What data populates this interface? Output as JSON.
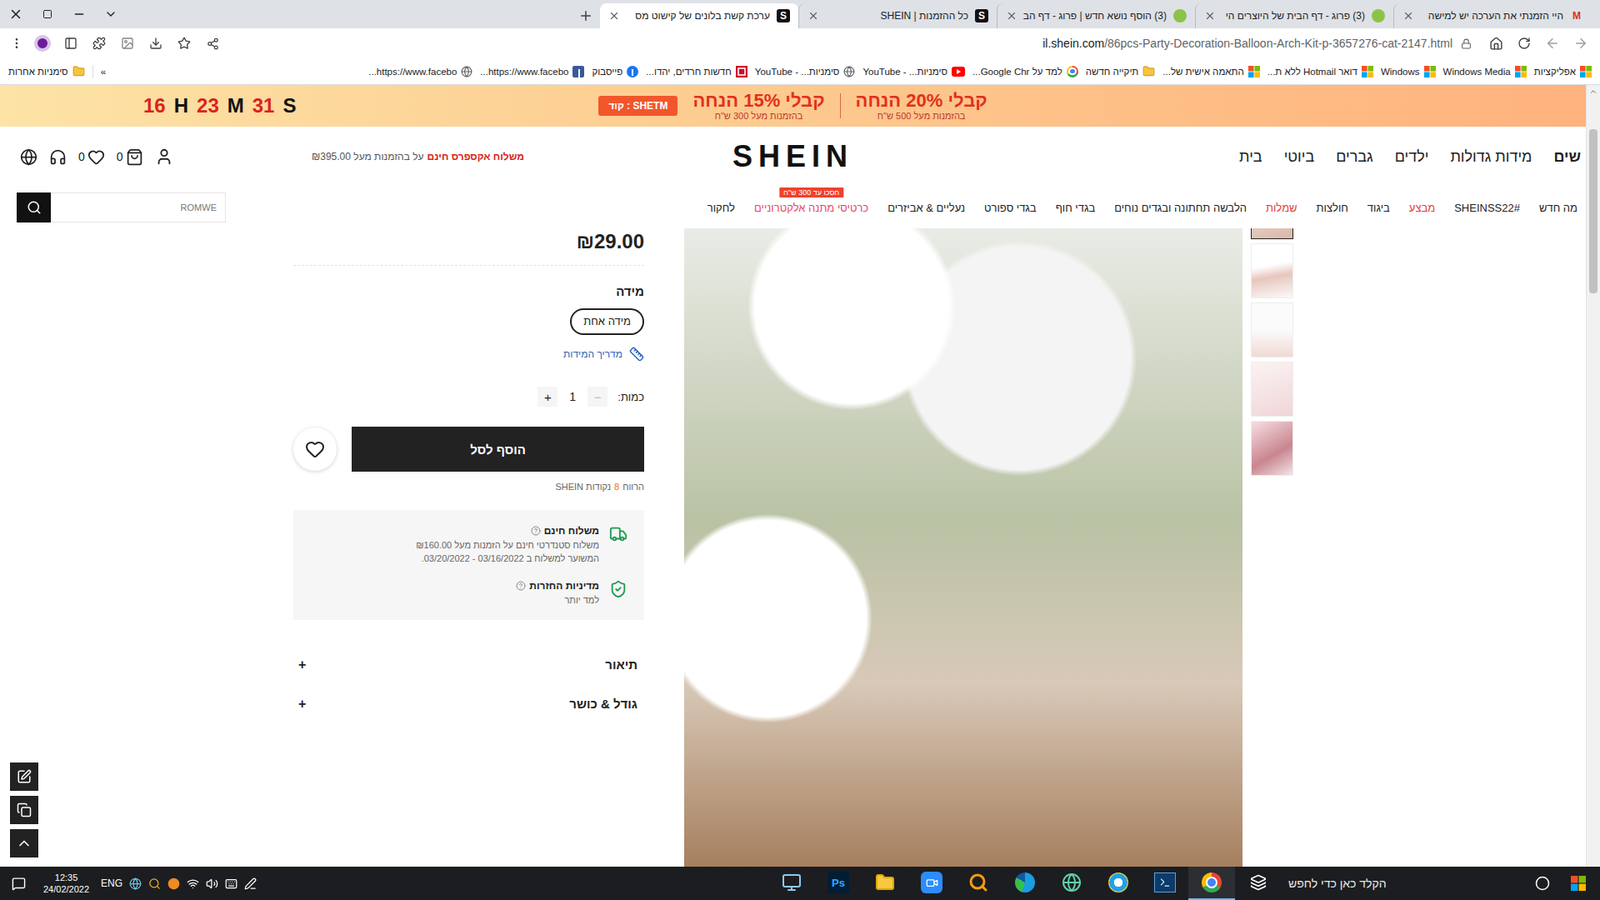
{
  "browser": {
    "tabs": [
      {
        "title": "היי הזמנתי את הערכה יש למישה",
        "selected": false,
        "favicon": {
          "kind": "gmail",
          "text": "M"
        }
      },
      {
        "title": "(3) פרוג - דף הבית של היוצרים הי",
        "selected": false,
        "favicon": {
          "kind": "prog"
        }
      },
      {
        "title": "(3) הוסף נושא חדש | פרוג - דף הב",
        "selected": false,
        "favicon": {
          "kind": "prog"
        }
      },
      {
        "title": "כל ההזמנות | SHEIN",
        "selected": false,
        "favicon": {
          "kind": "shein",
          "text": "S"
        }
      },
      {
        "title": "ערכת קשת בלונים של קישוט מס",
        "selected": true,
        "favicon": {
          "kind": "shein",
          "text": "S"
        }
      }
    ],
    "address": {
      "host": "il.shein.com",
      "path": "/86pcs-Party-Decoration-Balloon-Arch-Kit-p-3657276-cat-2147.html"
    },
    "bookmarks": [
      {
        "label": "אפליקציות",
        "kind": "apps"
      },
      {
        "label": "Windows Media",
        "kind": "windows"
      },
      {
        "label": "Windows",
        "kind": "windows"
      },
      {
        "label": "דואר Hotmail ללא ת...",
        "kind": "windows"
      },
      {
        "label": "התאמה אישית של...",
        "kind": "windows"
      },
      {
        "label": "תיקייה חדשה",
        "kind": "folder"
      },
      {
        "label": "למד על Google Chr...",
        "kind": "chrome"
      },
      {
        "label": "סימניות... - YouTube",
        "kind": "youtube"
      },
      {
        "label": "סימניות... - YouTube",
        "kind": "globe"
      },
      {
        "label": "חדשות חרדים, יהדו...",
        "kind": "news"
      },
      {
        "label": "פייסבוק",
        "kind": "facebook"
      },
      {
        "label": "https://www.facebo...",
        "kind": "facebook-square"
      },
      {
        "label": "https://www.facebo...",
        "kind": "globe"
      }
    ],
    "bookmarks_overflow": "»",
    "other_bookmarks": "סימניות אחרות"
  },
  "promo": {
    "countdown": [
      {
        "value": "16",
        "unit": "H"
      },
      {
        "value": "23",
        "unit": "M"
      },
      {
        "value": "31",
        "unit": "S"
      }
    ],
    "offers": [
      {
        "title": "קבלי 20% הנחה",
        "subtitle": "בהזמנות מעל 500 ש\"ח"
      },
      {
        "title": "קבלי 15% הנחה",
        "subtitle": "בהזמנות מעל 300 ש\"ח"
      }
    ],
    "code": "SHETM : קוד"
  },
  "header": {
    "nav": [
      {
        "label": "שים",
        "selected": true
      },
      {
        "label": "מידות גדולות",
        "selected": false
      },
      {
        "label": "ילדים",
        "selected": false
      },
      {
        "label": "גברים",
        "selected": false
      },
      {
        "label": "ביוטי",
        "selected": false
      },
      {
        "label": "בית",
        "selected": false
      }
    ],
    "logo": "SHEIN",
    "shipping": {
      "bold": "משלוח אקספרס חינם",
      "rest": "על בהזמנות מעל ₪395.00"
    },
    "wishlist_count": "0",
    "cart_count": "0"
  },
  "categories": [
    {
      "label": "מה חדש",
      "color": "#222222"
    },
    {
      "label": "#SHEINSS22",
      "color": "#222222"
    },
    {
      "label": "מבצע",
      "color": "#e23b3b"
    },
    {
      "label": "ביגוד",
      "color": "#222222"
    },
    {
      "label": "חולצות",
      "color": "#222222"
    },
    {
      "label": "שמלות",
      "color": "#e23b3b"
    },
    {
      "label": "הלבשה תחתונה ובגדים נוחים",
      "color": "#222222"
    },
    {
      "label": "בגדי חוף",
      "color": "#222222"
    },
    {
      "label": "בגדי ספורט",
      "color": "#222222"
    },
    {
      "label": "נעליים & אביזרים",
      "color": "#222222"
    },
    {
      "label": "כרטיסי מתנה אלקטרוניים",
      "color": "#e8475f",
      "badge": "חסכו עד 300 ש\"ח"
    },
    {
      "label": "לחקור",
      "color": "#222222"
    }
  ],
  "search": {
    "placeholder": "ROMWE"
  },
  "product": {
    "price": "₪29.00",
    "size_label": "מידה",
    "sizes": [
      {
        "label": "מידה אחת",
        "selected": true
      }
    ],
    "size_guide": "מדריך המידות",
    "quantity": {
      "label": "כמות:",
      "value": "1",
      "minus": "−",
      "plus": "+",
      "minus_disabled": true
    },
    "add_to_cart": "הוסף לסל",
    "wishlisted": false,
    "points": {
      "prefix": "הרווח",
      "value": "8",
      "suffix": "נקודות SHEIN"
    },
    "info": [
      {
        "kind": "shipping",
        "title": "משלוח חינם",
        "lines": [
          "משלוח סטנדרטי חינם על הזמנות מעל ₪160.00",
          "המשוער למשלוח ב 03/16/2022 - 03/20/2022."
        ]
      },
      {
        "kind": "returns",
        "title": "מדיניות החזרות",
        "lines": [
          "למד יותר"
        ]
      }
    ],
    "sections": [
      {
        "label": "תיאור",
        "expanded": false,
        "toggle": "+"
      },
      {
        "label": "גודל & כושר",
        "expanded": false,
        "toggle": "+"
      }
    ],
    "thumbnails": [
      {
        "selected": true
      },
      {
        "selected": false
      },
      {
        "selected": false
      },
      {
        "selected": false
      },
      {
        "selected": false
      }
    ]
  },
  "scrollbar": {
    "level": 0.05
  },
  "taskbar": {
    "search_placeholder": "הקלד כאן כדי לחפש",
    "apps": [
      {
        "kind": "chrome",
        "active": true
      },
      {
        "kind": "terminal",
        "active": false
      },
      {
        "kind": "ie",
        "active": false
      },
      {
        "kind": "globe",
        "active": false
      },
      {
        "kind": "edge",
        "active": false
      },
      {
        "kind": "magnifier",
        "active": false
      },
      {
        "kind": "zoom",
        "active": false
      },
      {
        "kind": "folder",
        "active": false
      },
      {
        "kind": "photoshop",
        "active": false,
        "label": "Ps"
      },
      {
        "kind": "monitor",
        "active": false
      }
    ],
    "language": "ENG",
    "time": "12:35",
    "date": "24/02/2022"
  }
}
